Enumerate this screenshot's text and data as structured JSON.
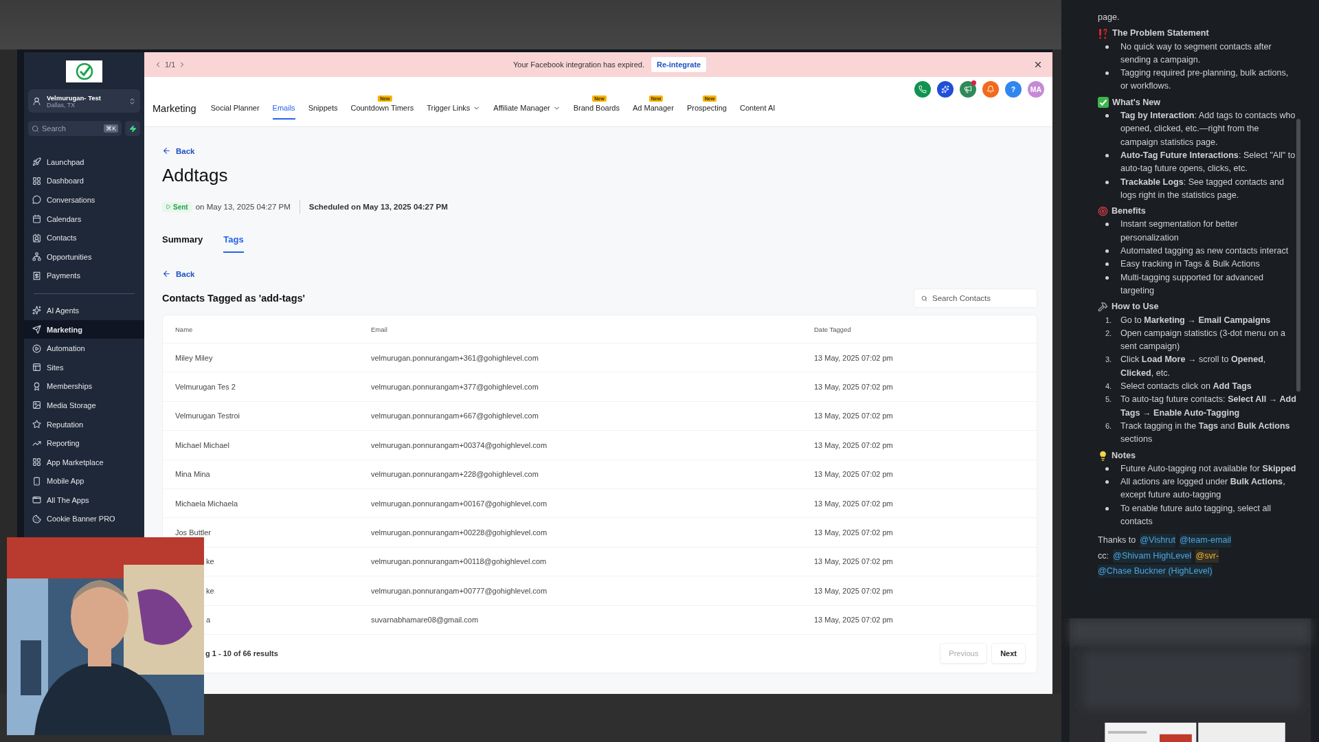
{
  "sidebar": {
    "account": {
      "name": "Velmurugan- Test",
      "location": "Dallas, TX"
    },
    "search": {
      "placeholder": "Search",
      "shortcut": "⌘K"
    },
    "groups": [
      [
        {
          "label": "Launchpad",
          "selected": false
        },
        {
          "label": "Dashboard",
          "selected": false
        },
        {
          "label": "Conversations",
          "selected": false
        },
        {
          "label": "Calendars",
          "selected": false
        },
        {
          "label": "Contacts",
          "selected": false
        },
        {
          "label": "Opportunities",
          "selected": false
        },
        {
          "label": "Payments",
          "selected": false
        }
      ],
      [
        {
          "label": "AI Agents",
          "selected": false
        },
        {
          "label": "Marketing",
          "selected": true
        },
        {
          "label": "Automation",
          "selected": false
        },
        {
          "label": "Sites",
          "selected": false
        },
        {
          "label": "Memberships",
          "selected": false
        },
        {
          "label": "Media Storage",
          "selected": false
        },
        {
          "label": "Reputation",
          "selected": false
        },
        {
          "label": "Reporting",
          "selected": false
        },
        {
          "label": "App Marketplace",
          "selected": false
        },
        {
          "label": "Mobile App",
          "selected": false
        },
        {
          "label": "All The Apps",
          "selected": false
        },
        {
          "label": "Cookie Banner PRO",
          "selected": false
        }
      ]
    ]
  },
  "banner": {
    "pager": "1/1",
    "message": "Your Facebook integration has expired.",
    "action": "Re-integrate"
  },
  "header_actions": [
    {
      "kind": "phone",
      "color": "#11934f",
      "notification": false
    },
    {
      "kind": "sparkle",
      "color": "#1f4fd8",
      "notification": false
    },
    {
      "kind": "megaphone",
      "color": "#2f8a5a",
      "notification": true
    },
    {
      "kind": "bell",
      "color": "#f26a1b",
      "notification": false
    },
    {
      "kind": "help",
      "label": "?",
      "color": "#2f86f0",
      "notification": false
    },
    {
      "kind": "avatar",
      "label": "MA",
      "color": "#c58ad6",
      "notification": false
    }
  ],
  "nav": {
    "title": "Marketing",
    "tabs": [
      {
        "label": "Social Planner",
        "selected": false,
        "has_menu": false
      },
      {
        "label": "Emails",
        "selected": true,
        "has_menu": false
      },
      {
        "label": "Snippets",
        "selected": false,
        "has_menu": false
      },
      {
        "label": "Countdown Timers",
        "selected": false,
        "has_menu": false,
        "badge": "New"
      },
      {
        "label": "Trigger Links",
        "selected": false,
        "has_menu": true
      },
      {
        "label": "Affiliate Manager",
        "selected": false,
        "has_menu": true
      },
      {
        "label": "Brand Boards",
        "selected": false,
        "has_menu": false,
        "badge": "New"
      },
      {
        "label": "Ad Manager",
        "selected": false,
        "has_menu": false,
        "badge": "New"
      },
      {
        "label": "Prospecting",
        "selected": false,
        "has_menu": false,
        "badge": "New"
      },
      {
        "label": "Content AI",
        "selected": false,
        "has_menu": false
      }
    ]
  },
  "page": {
    "back": "Back",
    "title": "Addtags",
    "status": "Sent",
    "sent_on": "on May 13, 2025 04:27 PM",
    "scheduled": "Scheduled on May 13, 2025 04:27 PM",
    "tabs": [
      {
        "label": "Summary",
        "selected": false
      },
      {
        "label": "Tags",
        "selected": true
      }
    ],
    "back_2": "Back",
    "heading": "Contacts Tagged as 'add-tags'",
    "search": {
      "placeholder": "Search Contacts"
    },
    "table": {
      "columns": [
        "Name",
        "Email",
        "Date Tagged"
      ],
      "rows": [
        {
          "name": "Miley Miley",
          "email": "velmurugan.ponnurangam+361@gohighlevel.com",
          "date": "13 May, 2025 07:02 pm",
          "partial": false
        },
        {
          "name": "Velmurugan Tes 2",
          "email": "velmurugan.ponnurangam+377@gohighlevel.com",
          "date": "13 May, 2025 07:02 pm",
          "partial": false
        },
        {
          "name": "Velmurugan Testroi",
          "email": "velmurugan.ponnurangam+667@gohighlevel.com",
          "date": "13 May, 2025 07:02 pm",
          "partial": false
        },
        {
          "name": "Michael Michael",
          "email": "velmurugan.ponnurangam+00374@gohighlevel.com",
          "date": "13 May, 2025 07:02 pm",
          "partial": false
        },
        {
          "name": "Mina Mina",
          "email": "velmurugan.ponnurangam+228@gohighlevel.com",
          "date": "13 May, 2025 07:02 pm",
          "partial": false
        },
        {
          "name": "Michaela Michaela",
          "email": "velmurugan.ponnurangam+00167@gohighlevel.com",
          "date": "13 May, 2025 07:02 pm",
          "partial": false
        },
        {
          "name": "Jos Buttler",
          "email": "velmurugan.ponnurangam+00228@gohighlevel.com",
          "date": "13 May, 2025 07:02 pm",
          "partial": false
        },
        {
          "name": "ke",
          "email": "velmurugan.ponnurangam+00118@gohighlevel.com",
          "date": "13 May, 2025 07:02 pm",
          "partial": true
        },
        {
          "name": "ke",
          "email": "velmurugan.ponnurangam+00777@gohighlevel.com",
          "date": "13 May, 2025 07:02 pm",
          "partial": true
        },
        {
          "name": "a",
          "email": "suvarnabhamare08@gmail.com",
          "date": "13 May, 2025 07:02 pm",
          "partial": true
        }
      ]
    },
    "footer": {
      "summary": "g 1 - 10 of 66 results",
      "previous": {
        "label": "Previous",
        "disabled": true
      },
      "next": {
        "label": "Next",
        "disabled": false
      }
    }
  },
  "thread": {
    "intro": "page.",
    "sections": [
      {
        "heading": "The Problem Statement",
        "ordered": false,
        "items": [
          "No quick way to segment contacts after sending a campaign.",
          "Tagging required pre-planning, bulk actions, or workflows."
        ]
      },
      {
        "heading": "What's New",
        "ordered": false,
        "items": [
          "**Tag by Interaction**: Add tags to contacts who opened, clicked, etc.—right from the campaign statistics page.",
          "**Auto-Tag Future Interactions**: Select \"All\" to auto-tag future opens, clicks, etc.",
          "**Trackable Logs**: See tagged contacts and logs right in the statistics page."
        ]
      },
      {
        "heading": "Benefits",
        "ordered": false,
        "items": [
          "Instant segmentation for better personalization",
          "Automated tagging as new contacts interact",
          "Easy tracking in Tags & Bulk Actions",
          "Multi-tagging supported for advanced targeting"
        ]
      },
      {
        "heading": "How to Use",
        "ordered": true,
        "numbers": [
          "1.",
          "2.",
          "3.",
          "4.",
          "5.",
          "6."
        ],
        "items": [
          "Go to **Marketing → Email Campaigns**",
          "Open campaign statistics (3-dot menu on a sent campaign)",
          "Click **Load More** → scroll to **Opened**, **Clicked**, etc.",
          "Select contacts click on **Add Tags**",
          "To auto-tag future contacts: **Select All → Add Tags → Enable Auto-Tagging**",
          "Track tagging in the **Tags** and **Bulk Actions** sections"
        ]
      },
      {
        "heading": "Notes",
        "ordered": false,
        "items": [
          "Future Auto-tagging not available for **Skipped**",
          "All actions are logged under **Bulk Actions**, except future auto-tagging",
          "To enable future auto tagging, select all contacts"
        ]
      }
    ],
    "credits": [
      [
        {
          "text": "Thanks to",
          "kind": "plain"
        },
        {
          "text": "@Vishrut",
          "kind": "mention"
        },
        {
          "text": "@team-email",
          "kind": "mention"
        }
      ],
      [
        {
          "text": "cc:",
          "kind": "plain"
        },
        {
          "text": "@Shivam HighLevel",
          "kind": "mention"
        },
        {
          "text": "@svr-",
          "kind": "highlight"
        }
      ],
      [
        {
          "text": "@Chase Buckner (HighLevel)",
          "kind": "mention"
        }
      ]
    ]
  }
}
